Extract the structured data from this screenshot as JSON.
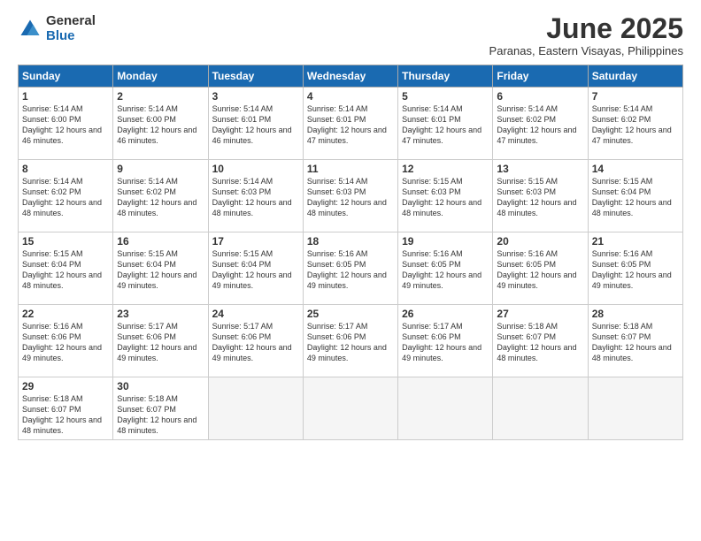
{
  "logo": {
    "general": "General",
    "blue": "Blue"
  },
  "header": {
    "month": "June 2025",
    "location": "Paranas, Eastern Visayas, Philippines"
  },
  "weekdays": [
    "Sunday",
    "Monday",
    "Tuesday",
    "Wednesday",
    "Thursday",
    "Friday",
    "Saturday"
  ],
  "weeks": [
    [
      {
        "day": 1,
        "sunrise": "5:14 AM",
        "sunset": "6:00 PM",
        "daylight": "12 hours and 46 minutes."
      },
      {
        "day": 2,
        "sunrise": "5:14 AM",
        "sunset": "6:00 PM",
        "daylight": "12 hours and 46 minutes."
      },
      {
        "day": 3,
        "sunrise": "5:14 AM",
        "sunset": "6:01 PM",
        "daylight": "12 hours and 46 minutes."
      },
      {
        "day": 4,
        "sunrise": "5:14 AM",
        "sunset": "6:01 PM",
        "daylight": "12 hours and 47 minutes."
      },
      {
        "day": 5,
        "sunrise": "5:14 AM",
        "sunset": "6:01 PM",
        "daylight": "12 hours and 47 minutes."
      },
      {
        "day": 6,
        "sunrise": "5:14 AM",
        "sunset": "6:02 PM",
        "daylight": "12 hours and 47 minutes."
      },
      {
        "day": 7,
        "sunrise": "5:14 AM",
        "sunset": "6:02 PM",
        "daylight": "12 hours and 47 minutes."
      }
    ],
    [
      {
        "day": 8,
        "sunrise": "5:14 AM",
        "sunset": "6:02 PM",
        "daylight": "12 hours and 48 minutes."
      },
      {
        "day": 9,
        "sunrise": "5:14 AM",
        "sunset": "6:02 PM",
        "daylight": "12 hours and 48 minutes."
      },
      {
        "day": 10,
        "sunrise": "5:14 AM",
        "sunset": "6:03 PM",
        "daylight": "12 hours and 48 minutes."
      },
      {
        "day": 11,
        "sunrise": "5:14 AM",
        "sunset": "6:03 PM",
        "daylight": "12 hours and 48 minutes."
      },
      {
        "day": 12,
        "sunrise": "5:15 AM",
        "sunset": "6:03 PM",
        "daylight": "12 hours and 48 minutes."
      },
      {
        "day": 13,
        "sunrise": "5:15 AM",
        "sunset": "6:03 PM",
        "daylight": "12 hours and 48 minutes."
      },
      {
        "day": 14,
        "sunrise": "5:15 AM",
        "sunset": "6:04 PM",
        "daylight": "12 hours and 48 minutes."
      }
    ],
    [
      {
        "day": 15,
        "sunrise": "5:15 AM",
        "sunset": "6:04 PM",
        "daylight": "12 hours and 48 minutes."
      },
      {
        "day": 16,
        "sunrise": "5:15 AM",
        "sunset": "6:04 PM",
        "daylight": "12 hours and 49 minutes."
      },
      {
        "day": 17,
        "sunrise": "5:15 AM",
        "sunset": "6:04 PM",
        "daylight": "12 hours and 49 minutes."
      },
      {
        "day": 18,
        "sunrise": "5:16 AM",
        "sunset": "6:05 PM",
        "daylight": "12 hours and 49 minutes."
      },
      {
        "day": 19,
        "sunrise": "5:16 AM",
        "sunset": "6:05 PM",
        "daylight": "12 hours and 49 minutes."
      },
      {
        "day": 20,
        "sunrise": "5:16 AM",
        "sunset": "6:05 PM",
        "daylight": "12 hours and 49 minutes."
      },
      {
        "day": 21,
        "sunrise": "5:16 AM",
        "sunset": "6:05 PM",
        "daylight": "12 hours and 49 minutes."
      }
    ],
    [
      {
        "day": 22,
        "sunrise": "5:16 AM",
        "sunset": "6:06 PM",
        "daylight": "12 hours and 49 minutes."
      },
      {
        "day": 23,
        "sunrise": "5:17 AM",
        "sunset": "6:06 PM",
        "daylight": "12 hours and 49 minutes."
      },
      {
        "day": 24,
        "sunrise": "5:17 AM",
        "sunset": "6:06 PM",
        "daylight": "12 hours and 49 minutes."
      },
      {
        "day": 25,
        "sunrise": "5:17 AM",
        "sunset": "6:06 PM",
        "daylight": "12 hours and 49 minutes."
      },
      {
        "day": 26,
        "sunrise": "5:17 AM",
        "sunset": "6:06 PM",
        "daylight": "12 hours and 49 minutes."
      },
      {
        "day": 27,
        "sunrise": "5:18 AM",
        "sunset": "6:07 PM",
        "daylight": "12 hours and 48 minutes."
      },
      {
        "day": 28,
        "sunrise": "5:18 AM",
        "sunset": "6:07 PM",
        "daylight": "12 hours and 48 minutes."
      }
    ],
    [
      {
        "day": 29,
        "sunrise": "5:18 AM",
        "sunset": "6:07 PM",
        "daylight": "12 hours and 48 minutes."
      },
      {
        "day": 30,
        "sunrise": "5:18 AM",
        "sunset": "6:07 PM",
        "daylight": "12 hours and 48 minutes."
      },
      null,
      null,
      null,
      null,
      null
    ]
  ]
}
